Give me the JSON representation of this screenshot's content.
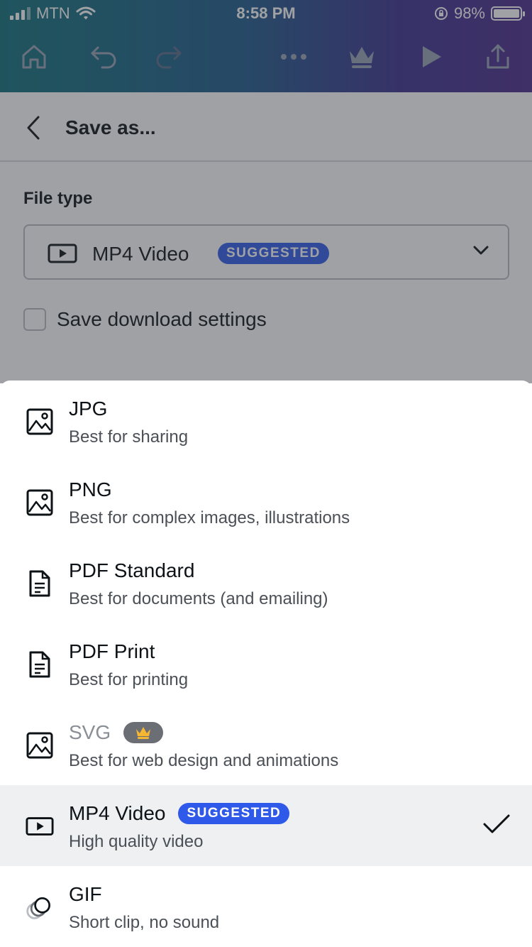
{
  "status_bar": {
    "carrier": "MTN",
    "time": "8:58 PM",
    "battery": "98%"
  },
  "toolbar": {
    "icons": [
      "home-icon",
      "undo-icon",
      "redo-icon",
      "more-icon",
      "crown-icon",
      "play-icon",
      "share-icon"
    ]
  },
  "panel": {
    "title": "Save as...",
    "file_type_label": "File type",
    "selected_type": "MP4 Video",
    "selected_badge": "SUGGESTED",
    "save_settings_label": "Save download settings",
    "save_settings_checked": false
  },
  "options": [
    {
      "name": "JPG",
      "desc": "Best for sharing",
      "icon": "image-icon"
    },
    {
      "name": "PNG",
      "desc": "Best for complex images, illustrations",
      "icon": "image-icon"
    },
    {
      "name": "PDF Standard",
      "desc": "Best for documents (and emailing)",
      "icon": "document-icon"
    },
    {
      "name": "PDF Print",
      "desc": "Best for printing",
      "icon": "document-icon"
    },
    {
      "name": "SVG",
      "desc": "Best for web design and animations",
      "icon": "image-icon",
      "pro": true
    },
    {
      "name": "MP4 Video",
      "desc": "High quality video",
      "icon": "video-icon",
      "badge": "SUGGESTED",
      "selected": true
    },
    {
      "name": "GIF",
      "desc": "Short clip, no sound",
      "icon": "gif-icon"
    }
  ],
  "colors": {
    "accent": "#2f59e8",
    "selected_row": "#eef0f2",
    "crown": "#f5b731"
  }
}
